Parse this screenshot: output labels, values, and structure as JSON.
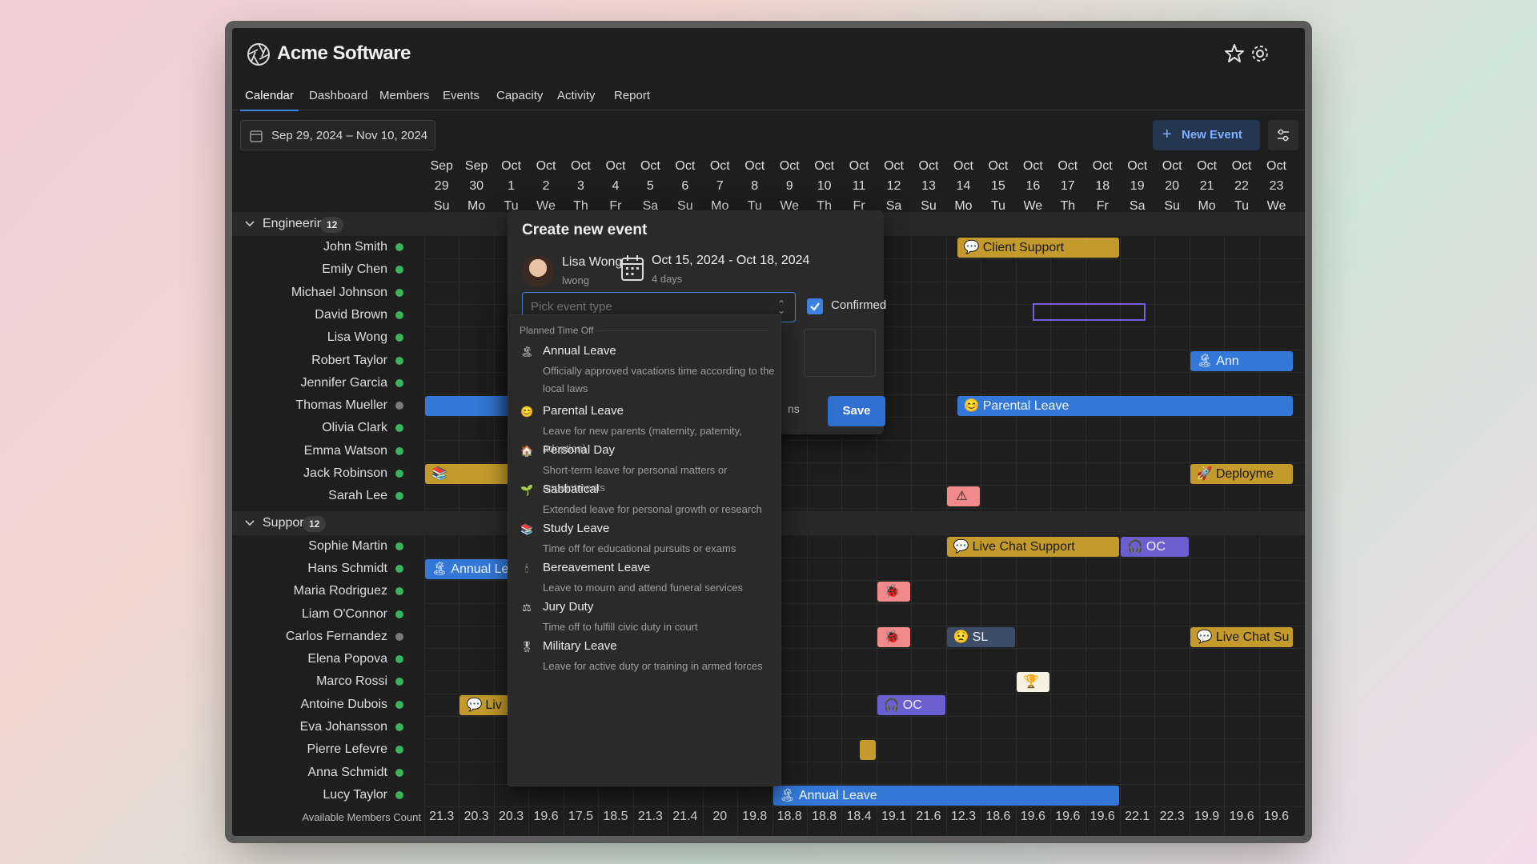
{
  "app": {
    "title": "Acme Software"
  },
  "header": {
    "favorite_icon": "star-icon",
    "settings_icon": "gear-icon"
  },
  "tabs": [
    {
      "label": "Calendar",
      "active": true
    },
    {
      "label": "Dashboard"
    },
    {
      "label": "Members"
    },
    {
      "label": "Events"
    },
    {
      "label": "Capacity"
    },
    {
      "label": "Activity"
    },
    {
      "label": "Report"
    }
  ],
  "toolbar": {
    "date_range": "Sep 29, 2024 – Nov 10, 2024",
    "new_event_label": "New Event",
    "filter_icon": "sliders-icon"
  },
  "days": [
    {
      "m": "Sep",
      "d": "29",
      "w": "Su"
    },
    {
      "m": "Sep",
      "d": "30",
      "w": "Mo"
    },
    {
      "m": "Oct",
      "d": "1",
      "w": "Tu"
    },
    {
      "m": "Oct",
      "d": "2",
      "w": "We"
    },
    {
      "m": "Oct",
      "d": "3",
      "w": "Th"
    },
    {
      "m": "Oct",
      "d": "4",
      "w": "Fr"
    },
    {
      "m": "Oct",
      "d": "5",
      "w": "Sa"
    },
    {
      "m": "Oct",
      "d": "6",
      "w": "Su"
    },
    {
      "m": "Oct",
      "d": "7",
      "w": "Mo"
    },
    {
      "m": "Oct",
      "d": "8",
      "w": "Tu"
    },
    {
      "m": "Oct",
      "d": "9",
      "w": "We"
    },
    {
      "m": "Oct",
      "d": "10",
      "w": "Th"
    },
    {
      "m": "Oct",
      "d": "11",
      "w": "Fr"
    },
    {
      "m": "Oct",
      "d": "12",
      "w": "Sa"
    },
    {
      "m": "Oct",
      "d": "13",
      "w": "Su"
    },
    {
      "m": "Oct",
      "d": "14",
      "w": "Mo"
    },
    {
      "m": "Oct",
      "d": "15",
      "w": "Tu"
    },
    {
      "m": "Oct",
      "d": "16",
      "w": "We"
    },
    {
      "m": "Oct",
      "d": "17",
      "w": "Th"
    },
    {
      "m": "Oct",
      "d": "18",
      "w": "Fr"
    },
    {
      "m": "Oct",
      "d": "19",
      "w": "Sa"
    },
    {
      "m": "Oct",
      "d": "20",
      "w": "Su"
    },
    {
      "m": "Oct",
      "d": "21",
      "w": "Mo"
    },
    {
      "m": "Oct",
      "d": "22",
      "w": "Tu"
    },
    {
      "m": "Oct",
      "d": "23",
      "w": "We"
    }
  ],
  "groups": [
    {
      "name": "Engineering",
      "count": "12",
      "members": [
        {
          "name": "John Smith",
          "online": true
        },
        {
          "name": "Emily Chen",
          "online": true
        },
        {
          "name": "Michael Johnson",
          "online": true
        },
        {
          "name": "David Brown",
          "online": true
        },
        {
          "name": "Lisa Wong",
          "online": true
        },
        {
          "name": "Robert Taylor",
          "online": true
        },
        {
          "name": "Jennifer Garcia",
          "online": true
        },
        {
          "name": "Thomas Mueller",
          "online": false
        },
        {
          "name": "Olivia Clark",
          "online": true
        },
        {
          "name": "Emma Watson",
          "online": true
        },
        {
          "name": "Jack Robinson",
          "online": true
        },
        {
          "name": "Sarah Lee",
          "online": true
        }
      ]
    },
    {
      "name": "Support",
      "count": "12",
      "members": [
        {
          "name": "Sophie Martin",
          "online": true
        },
        {
          "name": "Hans Schmidt",
          "online": true
        },
        {
          "name": "Maria Rodriguez",
          "online": true
        },
        {
          "name": "Liam O'Connor",
          "online": true
        },
        {
          "name": "Carlos Fernandez",
          "online": false
        },
        {
          "name": "Elena Popova",
          "online": true
        },
        {
          "name": "Marco Rossi",
          "online": true
        },
        {
          "name": "Antoine Dubois",
          "online": true
        },
        {
          "name": "Eva Johansson",
          "online": true
        },
        {
          "name": "Pierre Lefevre",
          "online": true
        },
        {
          "name": "Anna Schmidt",
          "online": true
        },
        {
          "name": "Lucy Taylor",
          "online": true
        }
      ]
    }
  ],
  "events": [
    {
      "label": "Client Support",
      "icon": "💬",
      "color": "gold",
      "row": 0,
      "g": 0,
      "from": 15.3,
      "to": 20
    },
    {
      "label": "Parental Leave",
      "icon": "😊",
      "color": "blue",
      "row": 7,
      "g": 0,
      "from": 15.3,
      "to": 25
    },
    {
      "label": "",
      "icon": "",
      "color": "blue",
      "row": 7,
      "g": 0,
      "from": 0,
      "to": 2.5
    },
    {
      "label": "",
      "icon": "📚",
      "color": "gold",
      "row": 10,
      "g": 0,
      "from": 0,
      "to": 2.5
    },
    {
      "label": "Ann",
      "icon": "🏝",
      "color": "blue",
      "row": 5,
      "g": 0,
      "from": 22,
      "to": 25
    },
    {
      "label": "Deployme",
      "icon": "🚀",
      "color": "gold",
      "row": 10,
      "g": 0,
      "from": 22,
      "to": 25
    },
    {
      "label": "",
      "icon": "⚠",
      "color": "pink",
      "row": 11,
      "g": 0,
      "from": 15,
      "to": 16
    },
    {
      "label": "Live Chat Support",
      "icon": "💬",
      "color": "gold",
      "row": 0,
      "g": 1,
      "from": 15,
      "to": 20
    },
    {
      "label": "OC",
      "icon": "🎧",
      "color": "purple",
      "row": 0,
      "g": 1,
      "from": 20,
      "to": 22
    },
    {
      "label": "Annual Le",
      "icon": "🏝",
      "color": "blue",
      "row": 1,
      "g": 1,
      "from": 0,
      "to": 2.5
    },
    {
      "label": "",
      "icon": "🐞",
      "color": "pink",
      "row": 2,
      "g": 1,
      "from": 13,
      "to": 14
    },
    {
      "label": "",
      "icon": "🐞",
      "color": "pink",
      "row": 4,
      "g": 1,
      "from": 13,
      "to": 14
    },
    {
      "label": "SL",
      "icon": "😟",
      "color": "steel",
      "row": 4,
      "g": 1,
      "from": 15,
      "to": 17
    },
    {
      "label": "Live Chat Su",
      "icon": "💬",
      "color": "gold",
      "row": 4,
      "g": 1,
      "from": 22,
      "to": 25
    },
    {
      "label": "",
      "icon": "🏆",
      "color": "white",
      "row": 6,
      "g": 1,
      "from": 17,
      "to": 18
    },
    {
      "label": "Liv",
      "icon": "💬",
      "color": "gold",
      "row": 7,
      "g": 1,
      "from": 1,
      "to": 2.5
    },
    {
      "label": "OC",
      "icon": "🎧",
      "color": "purple",
      "row": 7,
      "g": 1,
      "from": 13,
      "to": 15
    },
    {
      "label": "",
      "icon": "",
      "color": "gold",
      "row": 9,
      "g": 1,
      "from": 12.5,
      "to": 13
    },
    {
      "label": "Annual Leave",
      "icon": "🏝",
      "color": "blue",
      "row": 11,
      "g": 1,
      "from": 10,
      "to": 20
    }
  ],
  "footer": {
    "label": "Available Members Count",
    "counts": [
      "21.3",
      "20.3",
      "20.3",
      "19.6",
      "17.5",
      "18.5",
      "21.3",
      "21.4",
      "20",
      "19.8",
      "18.8",
      "18.8",
      "18.4",
      "19.1",
      "21.6",
      "12.3",
      "18.6",
      "19.6",
      "19.6",
      "19.6",
      "22.1",
      "22.3",
      "19.9",
      "19.6",
      "19.6"
    ]
  },
  "modal": {
    "title": "Create new event",
    "user_name": "Lisa Wong",
    "user_handle": "lwong",
    "date_range": "Oct 15, 2024 - Oct 18, 2024",
    "duration": "4 days",
    "event_type_placeholder": "Pick event type",
    "confirmed_label": "Confirmed",
    "partial_text": "ns",
    "save_label": "Save"
  },
  "dropdown": {
    "group_label": "Planned Time Off",
    "options": [
      {
        "icon": "🏝",
        "title": "Annual Leave",
        "desc": "Officially approved vacations time according to the local laws"
      },
      {
        "icon": "😊",
        "title": "Parental Leave",
        "desc": "Leave for new parents (maternity, paternity, adoption)"
      },
      {
        "icon": "🏠",
        "title": "Personal Day",
        "desc": "Short-term leave for personal matters or appointments"
      },
      {
        "icon": "🌱",
        "title": "Sabbatical",
        "desc": "Extended leave for personal growth or research"
      },
      {
        "icon": "📚",
        "title": "Study Leave",
        "desc": "Time off for educational pursuits or exams"
      },
      {
        "icon": "🕯",
        "title": "Bereavement Leave",
        "desc": "Leave to mourn and attend funeral services"
      },
      {
        "icon": "⚖",
        "title": "Jury Duty",
        "desc": "Time off to fulfill civic duty in court"
      },
      {
        "icon": "🎖",
        "title": "Military Leave",
        "desc": "Leave for active duty or training in armed forces"
      }
    ]
  }
}
